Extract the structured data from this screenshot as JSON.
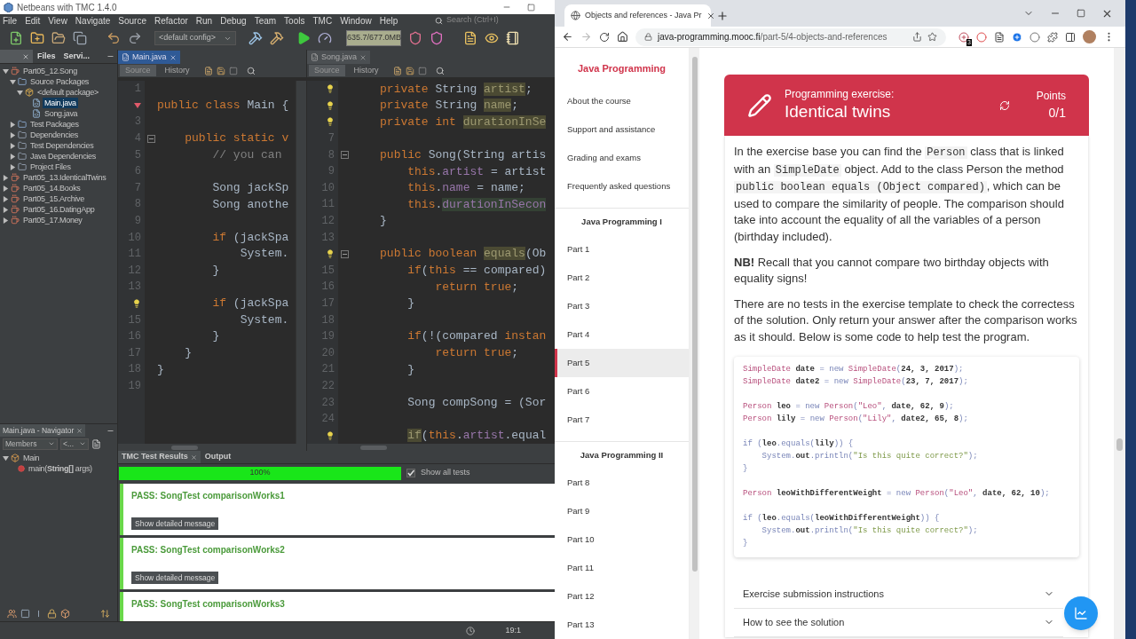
{
  "netbeans": {
    "title": "Netbeans with TMC 1.4.0",
    "menu": [
      "File",
      "Edit",
      "View",
      "Navigate",
      "Source",
      "Refactor",
      "Run",
      "Debug",
      "Team",
      "Tools",
      "TMC",
      "Window",
      "Help"
    ],
    "search_placeholder": "Search (Ctrl+I)",
    "config": "<default config>",
    "memory": "635.7/677.0MB",
    "side_tabs": [
      {
        "closable": true,
        "selected": true
      },
      {
        "label": "Files",
        "selected": false,
        "closable": false
      },
      {
        "label": "Servi...",
        "selected": false,
        "closable": false
      }
    ],
    "tree": [
      {
        "label": "Part05_12.Song",
        "kind": "project",
        "expanded": true,
        "selected": false,
        "children": [
          {
            "label": "Source Packages",
            "kind": "sources",
            "expanded": true,
            "selected": false,
            "children": [
              {
                "label": "<default package>",
                "kind": "package",
                "expanded": true,
                "selected": false,
                "children": [
                  {
                    "label": "Main.java",
                    "kind": "java",
                    "selected": true
                  },
                  {
                    "label": "Song.java",
                    "kind": "java",
                    "selected": false
                  }
                ]
              }
            ]
          },
          {
            "label": "Test Packages",
            "kind": "sources",
            "expanded": false,
            "selected": false
          },
          {
            "label": "Dependencies",
            "kind": "library",
            "expanded": false,
            "selected": false
          },
          {
            "label": "Test Dependencies",
            "kind": "library",
            "expanded": false,
            "selected": false
          },
          {
            "label": "Java Dependencies",
            "kind": "library",
            "expanded": false,
            "selected": false
          },
          {
            "label": "Project Files",
            "kind": "library",
            "expanded": false,
            "selected": false
          }
        ]
      },
      {
        "label": "Part05_13.IdenticalTwins",
        "kind": "project",
        "expanded": false,
        "selected": false
      },
      {
        "label": "Part05_14.Books",
        "kind": "project",
        "expanded": false,
        "selected": false
      },
      {
        "label": "Part05_15.Archive",
        "kind": "project",
        "expanded": false,
        "selected": false
      },
      {
        "label": "Part05_16.DatingApp",
        "kind": "project",
        "expanded": false,
        "selected": false
      },
      {
        "label": "Part05_17.Money",
        "kind": "project",
        "expanded": false,
        "selected": false
      }
    ],
    "navigator": {
      "title": "Main.java - Navigator",
      "filter": "Members",
      "history": "<...",
      "tree": [
        {
          "label": "Main",
          "kind": "class",
          "expanded": true,
          "selected": false,
          "children": [
            {
              "label": "main(**String[]** args)",
              "kind": "method",
              "selected": false
            }
          ]
        }
      ]
    },
    "editors": [
      {
        "tab": "Main.java",
        "focused": true,
        "views": [
          {
            "label": "Source",
            "selected": true
          },
          {
            "label": "History",
            "selected": false
          }
        ],
        "lines": [
          {
            "number": "1"
          },
          {
            "kind": "error",
            "code": [
              {
                "kind": "keyword",
                "text": "public class "
              },
              {
                "kind": "plain",
                "text": "Main {"
              }
            ]
          },
          {
            "number": "3"
          },
          {
            "number": "4",
            "foldable": true,
            "code": [
              {
                "kind": "keyword",
                "text": "    public static v"
              }
            ]
          },
          {
            "number": "5",
            "code": [
              {
                "kind": "comment",
                "text": "        // you can"
              }
            ]
          },
          {
            "number": "6"
          },
          {
            "number": "7",
            "code": [
              {
                "kind": "plain",
                "text": "        Song jackSp"
              }
            ]
          },
          {
            "number": "8",
            "code": [
              {
                "kind": "plain",
                "text": "        Song anothe"
              }
            ]
          },
          {
            "number": "9"
          },
          {
            "number": "10",
            "code": [
              {
                "kind": "keyword",
                "text": "        if "
              },
              {
                "kind": "plain",
                "text": "(jackSpa"
              }
            ]
          },
          {
            "number": "11",
            "code": [
              {
                "kind": "plain",
                "text": "            System."
              }
            ]
          },
          {
            "number": "12",
            "code": [
              {
                "kind": "plain",
                "text": "        }"
              }
            ]
          },
          {
            "number": "13"
          },
          {
            "kind": "bulb",
            "code": [
              {
                "kind": "keyword",
                "text": "        if "
              },
              {
                "kind": "plain",
                "text": "(jackSpa"
              }
            ]
          },
          {
            "number": "15",
            "code": [
              {
                "kind": "plain",
                "text": "            System."
              }
            ]
          },
          {
            "number": "16",
            "code": [
              {
                "kind": "plain",
                "text": "        }"
              }
            ]
          },
          {
            "number": "17",
            "code": [
              {
                "kind": "plain",
                "text": "    }"
              }
            ]
          },
          {
            "number": "18",
            "code": [
              {
                "kind": "plain",
                "text": "}"
              }
            ]
          },
          {
            "number": "19"
          }
        ]
      },
      {
        "tab": "Song.java",
        "focused": false,
        "views": [
          {
            "label": "Source",
            "selected": true
          },
          {
            "label": "History",
            "selected": false
          }
        ],
        "lines": [
          {
            "kind": "bulb",
            "code": [
              {
                "kind": "keyword",
                "text": "    private "
              },
              {
                "kind": "plain",
                "text": "String "
              },
              {
                "kind": "mark",
                "text": "artist"
              },
              {
                "kind": "plain",
                "text": ";"
              }
            ]
          },
          {
            "kind": "bulb",
            "code": [
              {
                "kind": "keyword",
                "text": "    private "
              },
              {
                "kind": "plain",
                "text": "String "
              },
              {
                "kind": "mark",
                "text": "name"
              },
              {
                "kind": "plain",
                "text": ";"
              }
            ]
          },
          {
            "kind": "bulb",
            "code": [
              {
                "kind": "keyword",
                "text": "    private int "
              },
              {
                "kind": "mark",
                "text": "durationInSe"
              }
            ]
          },
          {
            "number": "7"
          },
          {
            "number": "8",
            "foldable": true,
            "code": [
              {
                "kind": "keyword",
                "text": "    public "
              },
              {
                "kind": "plain",
                "text": "Song(String artis"
              }
            ]
          },
          {
            "number": "9",
            "code": [
              {
                "kind": "keyword",
                "text": "        this"
              },
              {
                "kind": "plain",
                "text": "."
              },
              {
                "kind": "field",
                "text": "artist"
              },
              {
                "kind": "plain",
                "text": " = artist"
              }
            ]
          },
          {
            "number": "10",
            "code": [
              {
                "kind": "keyword",
                "text": "        this"
              },
              {
                "kind": "plain",
                "text": "."
              },
              {
                "kind": "field",
                "text": "name"
              },
              {
                "kind": "plain",
                "text": " = name;"
              }
            ]
          },
          {
            "number": "11",
            "code": [
              {
                "kind": "keyword",
                "text": "        this"
              },
              {
                "kind": "plain",
                "text": "."
              },
              {
                "kind": "markgreen",
                "text": "durationInSecon"
              }
            ]
          },
          {
            "number": "12",
            "code": [
              {
                "kind": "plain",
                "text": "    }"
              }
            ]
          },
          {
            "number": "13"
          },
          {
            "kind": "bulb",
            "foldable": true,
            "code": [
              {
                "kind": "keyword",
                "text": "    public boolean "
              },
              {
                "kind": "mark",
                "text": "equals"
              },
              {
                "kind": "plain",
                "text": "(Ob"
              }
            ]
          },
          {
            "number": "15",
            "code": [
              {
                "kind": "keyword",
                "text": "        if"
              },
              {
                "kind": "plain",
                "text": "("
              },
              {
                "kind": "keyword",
                "text": "this"
              },
              {
                "kind": "plain",
                "text": " == compared)"
              }
            ]
          },
          {
            "number": "16",
            "code": [
              {
                "kind": "keyword",
                "text": "            return true"
              },
              {
                "kind": "plain",
                "text": ";"
              }
            ]
          },
          {
            "number": "17",
            "code": [
              {
                "kind": "plain",
                "text": "        }"
              }
            ]
          },
          {
            "number": "18"
          },
          {
            "number": "19",
            "code": [
              {
                "kind": "keyword",
                "text": "        if"
              },
              {
                "kind": "plain",
                "text": "(!(compared "
              },
              {
                "kind": "keyword",
                "text": "instan"
              }
            ]
          },
          {
            "number": "20",
            "code": [
              {
                "kind": "keyword",
                "text": "            return true"
              },
              {
                "kind": "plain",
                "text": ";"
              }
            ]
          },
          {
            "number": "21",
            "code": [
              {
                "kind": "plain",
                "text": "        }"
              }
            ]
          },
          {
            "number": "22"
          },
          {
            "number": "23",
            "code": [
              {
                "kind": "plain",
                "text": "        Song compSong = (Sor"
              }
            ]
          },
          {
            "number": "24"
          },
          {
            "kind": "bulb",
            "code": [
              {
                "kind": "mark",
                "text": "        if"
              },
              {
                "kind": "plain",
                "text": "("
              },
              {
                "kind": "keyword",
                "text": "this"
              },
              {
                "kind": "plain",
                "text": "."
              },
              {
                "kind": "field",
                "text": "artist"
              },
              {
                "kind": "plain",
                "text": ".equal"
              }
            ]
          }
        ]
      }
    ],
    "output": {
      "tabs": [
        {
          "label": "TMC Test Results",
          "selected": true,
          "closable": true
        },
        {
          "label": "Output",
          "selected": false,
          "closable": false
        }
      ],
      "progress": {
        "level": 1,
        "label": "100%"
      },
      "show_all": {
        "label": "Show all tests",
        "checked": true
      },
      "results": [
        {
          "title": "PASS: SongTest comparisonWorks1",
          "kind": "pass",
          "button": "Show detailed message"
        },
        {
          "title": "PASS: SongTest comparisonWorks2",
          "kind": "pass",
          "button": "Show detailed message"
        },
        {
          "title": "PASS: SongTest comparisonWorks3",
          "kind": "pass"
        }
      ]
    },
    "status_bar": {
      "position": "19:1"
    }
  },
  "browser": {
    "tab": "Objects and references - Java Pr",
    "url_host": "java-programming.mooc.fi",
    "url_path": "/part-5/4-objects-and-references",
    "extension_badge": "3",
    "sidebar": {
      "brand": "Java Programming",
      "groups": [
        {
          "items": [
            {
              "label": "About the course",
              "selected": false
            },
            {
              "label": "Support and assistance",
              "selected": false
            },
            {
              "label": "Grading and exams",
              "selected": false
            },
            {
              "label": "Frequently asked questions",
              "selected": false
            }
          ]
        },
        {
          "title": "Java Programming I",
          "items": [
            {
              "label": "Part 1",
              "selected": false
            },
            {
              "label": "Part 2",
              "selected": false
            },
            {
              "label": "Part 3",
              "selected": false
            },
            {
              "label": "Part 4",
              "selected": false
            },
            {
              "label": "Part 5",
              "selected": true
            },
            {
              "label": "Part 6",
              "selected": false
            },
            {
              "label": "Part 7",
              "selected": false
            }
          ]
        },
        {
          "title": "Java Programming II",
          "items": [
            {
              "label": "Part 8",
              "selected": false
            },
            {
              "label": "Part 9",
              "selected": false
            },
            {
              "label": "Part 10",
              "selected": false
            },
            {
              "label": "Part 11",
              "selected": false
            },
            {
              "label": "Part 12",
              "selected": false
            },
            {
              "label": "Part 13",
              "selected": false
            }
          ]
        }
      ]
    },
    "exercise": {
      "kicker": "Programming exercise:",
      "title": "Identical twins",
      "points_label": "Points",
      "points": "0/1",
      "paragraphs": [
        [
          {
            "text": "In the exercise base you can find the ",
            "code": false
          },
          {
            "text": "Person",
            "code": true
          },
          {
            "text": " class that is linked with an ",
            "code": false
          },
          {
            "text": "SimpleDate",
            "code": true
          },
          {
            "text": " object. Add to the class Person the method ",
            "code": false
          },
          {
            "text": "public boolean equals (Object compared)",
            "code": true
          },
          {
            "text": ", which can be used to compare the similarity of people. The comparison should take into account the equality of all the variables of a person (birthday included).",
            "code": false
          }
        ],
        [
          {
            "text": "**NB!** Recall that you cannot compare two birthday objects with equality signs!",
            "code": false
          }
        ],
        [
          {
            "text": "There are no tests in the exercise template to check the correctess of the solution. Only return your answer after the comparison works as it should. Below is some code to help test the program.",
            "code": false
          }
        ]
      ],
      "code": [
        {
          "kind": "code",
          "code": [
            {
              "kind": "type",
              "text": "SimpleDate "
            },
            {
              "kind": "plain",
              "text": "date "
            },
            {
              "kind": "op",
              "text": "= new "
            },
            {
              "kind": "type",
              "text": "SimpleDate"
            },
            {
              "kind": "op",
              "text": "("
            },
            {
              "kind": "plain",
              "text": "24, 3, 2017"
            },
            {
              "kind": "op",
              "text": ");"
            }
          ]
        },
        {
          "kind": "code",
          "code": [
            {
              "kind": "type",
              "text": "SimpleDate "
            },
            {
              "kind": "plain",
              "text": "date2 "
            },
            {
              "kind": "op",
              "text": "= new "
            },
            {
              "kind": "type",
              "text": "SimpleDate"
            },
            {
              "kind": "op",
              "text": "("
            },
            {
              "kind": "plain",
              "text": "23, 7, 2017"
            },
            {
              "kind": "op",
              "text": ");"
            }
          ]
        },
        {
          "kind": "blank"
        },
        {
          "kind": "code",
          "code": [
            {
              "kind": "type",
              "text": "Person "
            },
            {
              "kind": "plain",
              "text": "leo "
            },
            {
              "kind": "op",
              "text": "= new "
            },
            {
              "kind": "type",
              "text": "Person"
            },
            {
              "kind": "op",
              "text": "("
            },
            {
              "kind": "string",
              "text": "\"Leo\""
            },
            {
              "kind": "op",
              "text": ", "
            },
            {
              "kind": "plain",
              "text": "date, 62, 9"
            },
            {
              "kind": "op",
              "text": ");"
            }
          ]
        },
        {
          "kind": "code",
          "code": [
            {
              "kind": "type",
              "text": "Person "
            },
            {
              "kind": "plain",
              "text": "lily "
            },
            {
              "kind": "op",
              "text": "= new "
            },
            {
              "kind": "type",
              "text": "Person"
            },
            {
              "kind": "op",
              "text": "("
            },
            {
              "kind": "string",
              "text": "\"Lily\""
            },
            {
              "kind": "op",
              "text": ", "
            },
            {
              "kind": "plain",
              "text": "date2, 65, 8"
            },
            {
              "kind": "op",
              "text": ");"
            }
          ]
        },
        {
          "kind": "blank"
        },
        {
          "kind": "code",
          "code": [
            {
              "kind": "op",
              "text": "if ("
            },
            {
              "kind": "plain",
              "text": "leo"
            },
            {
              "kind": "op",
              "text": ".equals("
            },
            {
              "kind": "plain",
              "text": "lily"
            },
            {
              "kind": "op",
              "text": ")) {"
            }
          ]
        },
        {
          "kind": "code",
          "code": [
            {
              "kind": "op",
              "text": "    System."
            },
            {
              "kind": "plain",
              "text": "out"
            },
            {
              "kind": "op",
              "text": ".println("
            },
            {
              "kind": "message",
              "text": "\"Is this quite correct?\""
            },
            {
              "kind": "op",
              "text": ");"
            }
          ]
        },
        {
          "kind": "code",
          "code": [
            {
              "kind": "op",
              "text": "}"
            }
          ]
        },
        {
          "kind": "blank"
        },
        {
          "kind": "code",
          "code": [
            {
              "kind": "type",
              "text": "Person "
            },
            {
              "kind": "plain",
              "text": "leoWithDifferentWeight "
            },
            {
              "kind": "op",
              "text": "= new "
            },
            {
              "kind": "type",
              "text": "Person"
            },
            {
              "kind": "op",
              "text": "("
            },
            {
              "kind": "string",
              "text": "\"Leo\""
            },
            {
              "kind": "op",
              "text": ", "
            },
            {
              "kind": "plain",
              "text": "date, 62, 10"
            },
            {
              "kind": "op",
              "text": ");"
            }
          ]
        },
        {
          "kind": "blank"
        },
        {
          "kind": "code",
          "code": [
            {
              "kind": "op",
              "text": "if ("
            },
            {
              "kind": "plain",
              "text": "leo"
            },
            {
              "kind": "op",
              "text": ".equals("
            },
            {
              "kind": "plain",
              "text": "leoWithDifferentWeight"
            },
            {
              "kind": "op",
              "text": ")) {"
            }
          ]
        },
        {
          "kind": "code",
          "code": [
            {
              "kind": "op",
              "text": "    System."
            },
            {
              "kind": "plain",
              "text": "out"
            },
            {
              "kind": "op",
              "text": ".println("
            },
            {
              "kind": "message",
              "text": "\"Is this quite correct?\""
            },
            {
              "kind": "op",
              "text": ");"
            }
          ]
        },
        {
          "kind": "code",
          "code": [
            {
              "kind": "op",
              "text": "}"
            }
          ]
        }
      ],
      "accordions": [
        "Exercise submission instructions",
        "How to see the solution"
      ]
    }
  }
}
